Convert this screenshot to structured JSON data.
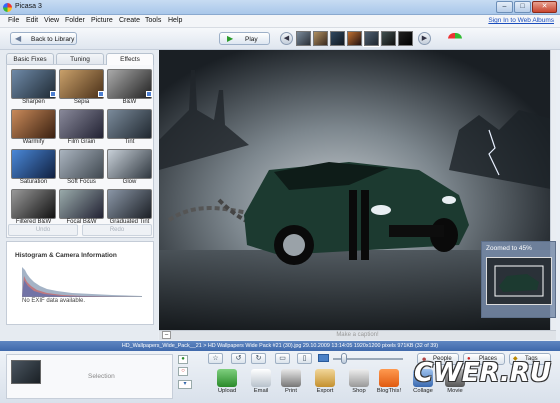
{
  "window": {
    "title": "Picasa 3",
    "minimize": "–",
    "maximize": "□",
    "close": "✕"
  },
  "menu": [
    "File",
    "Edit",
    "View",
    "Folder",
    "Picture",
    "Create",
    "Tools",
    "Help"
  ],
  "signin": "Sign In to Web Albums",
  "toolbar": {
    "back_label": "Back to Library",
    "play_label": "Play"
  },
  "tabs": [
    "Basic Fixes",
    "Tuning",
    "Effects"
  ],
  "effects": [
    {
      "label": "Sharpen"
    },
    {
      "label": "Sepia"
    },
    {
      "label": "B&W"
    },
    {
      "label": "Warmify"
    },
    {
      "label": "Film Grain"
    },
    {
      "label": "Tint"
    },
    {
      "label": "Saturation"
    },
    {
      "label": "Soft Focus"
    },
    {
      "label": "Glow"
    },
    {
      "label": "Filtered B&W"
    },
    {
      "label": "Focal B&W"
    },
    {
      "label": "Graduated Tint"
    }
  ],
  "undo_label": "Undo",
  "redo_label": "Redo",
  "histogram": {
    "title": "Histogram & Camera Information",
    "exif": "No EXIF data available."
  },
  "caption_placeholder": "Make a caption!",
  "infobar": "HD_Wallpapers_Wide_Pack__21 > HD Wallpapers Wide Pack #21 (30).jpg    29.10.2009 13:14:05    1920x1200 pixels    971KB    (32 of 39)",
  "zoom": {
    "label": "Zoomed to",
    "value": "45%"
  },
  "tray": {
    "selection": "Selection"
  },
  "tools": {
    "people": "People",
    "places": "Places",
    "tags": "Tags"
  },
  "actions": [
    {
      "label": "Upload"
    },
    {
      "label": "Email"
    },
    {
      "label": "Print"
    },
    {
      "label": "Export"
    },
    {
      "label": "Shop"
    },
    {
      "label": "BlogThis!"
    },
    {
      "label": "Collage"
    },
    {
      "label": "Movie"
    }
  ],
  "watermark": "CWER.RU",
  "colors": {
    "accent": "#4a73b3",
    "infobar": "#4a73b3",
    "play": "#2a9a2a"
  }
}
